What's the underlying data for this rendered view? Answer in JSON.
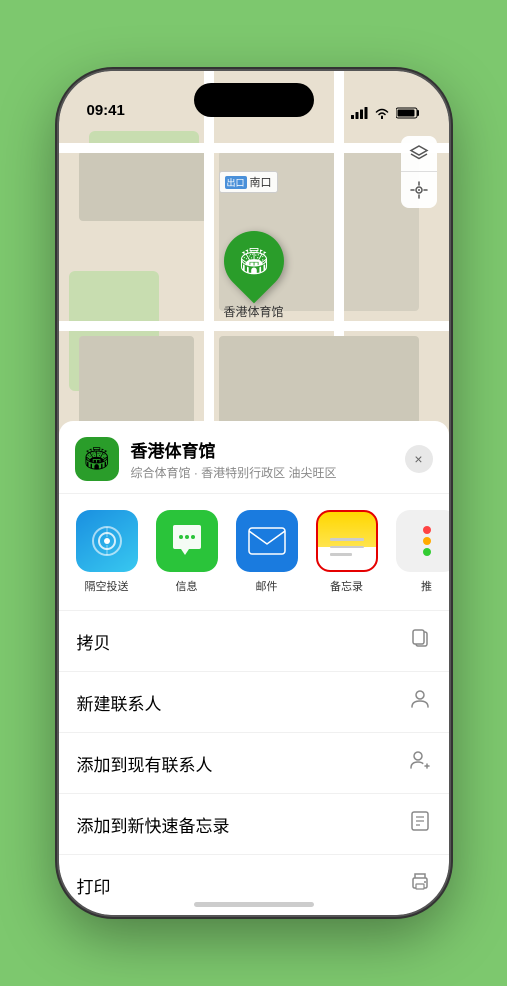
{
  "status_bar": {
    "time": "09:41",
    "signal_icon": "signal",
    "wifi_icon": "wifi",
    "battery_icon": "battery"
  },
  "map": {
    "label_tag": "出口",
    "label_text": "南口",
    "map_layer_icon": "🗺",
    "location_icon": "⬆"
  },
  "stadium": {
    "name": "香港体育馆",
    "description": "综合体育馆 · 香港特别行政区 油尖旺区"
  },
  "share_items": [
    {
      "id": "airdrop",
      "label": "隔空投送"
    },
    {
      "id": "message",
      "label": "信息"
    },
    {
      "id": "mail",
      "label": "邮件"
    },
    {
      "id": "notes",
      "label": "备忘录"
    },
    {
      "id": "more",
      "label": "推"
    }
  ],
  "actions": [
    {
      "id": "copy",
      "label": "拷贝",
      "icon": "copy"
    },
    {
      "id": "new-contact",
      "label": "新建联系人",
      "icon": "person"
    },
    {
      "id": "add-existing",
      "label": "添加到现有联系人",
      "icon": "person-add"
    },
    {
      "id": "add-notes",
      "label": "添加到新快速备忘录",
      "icon": "note"
    },
    {
      "id": "print",
      "label": "打印",
      "icon": "print"
    }
  ],
  "close_label": "×"
}
